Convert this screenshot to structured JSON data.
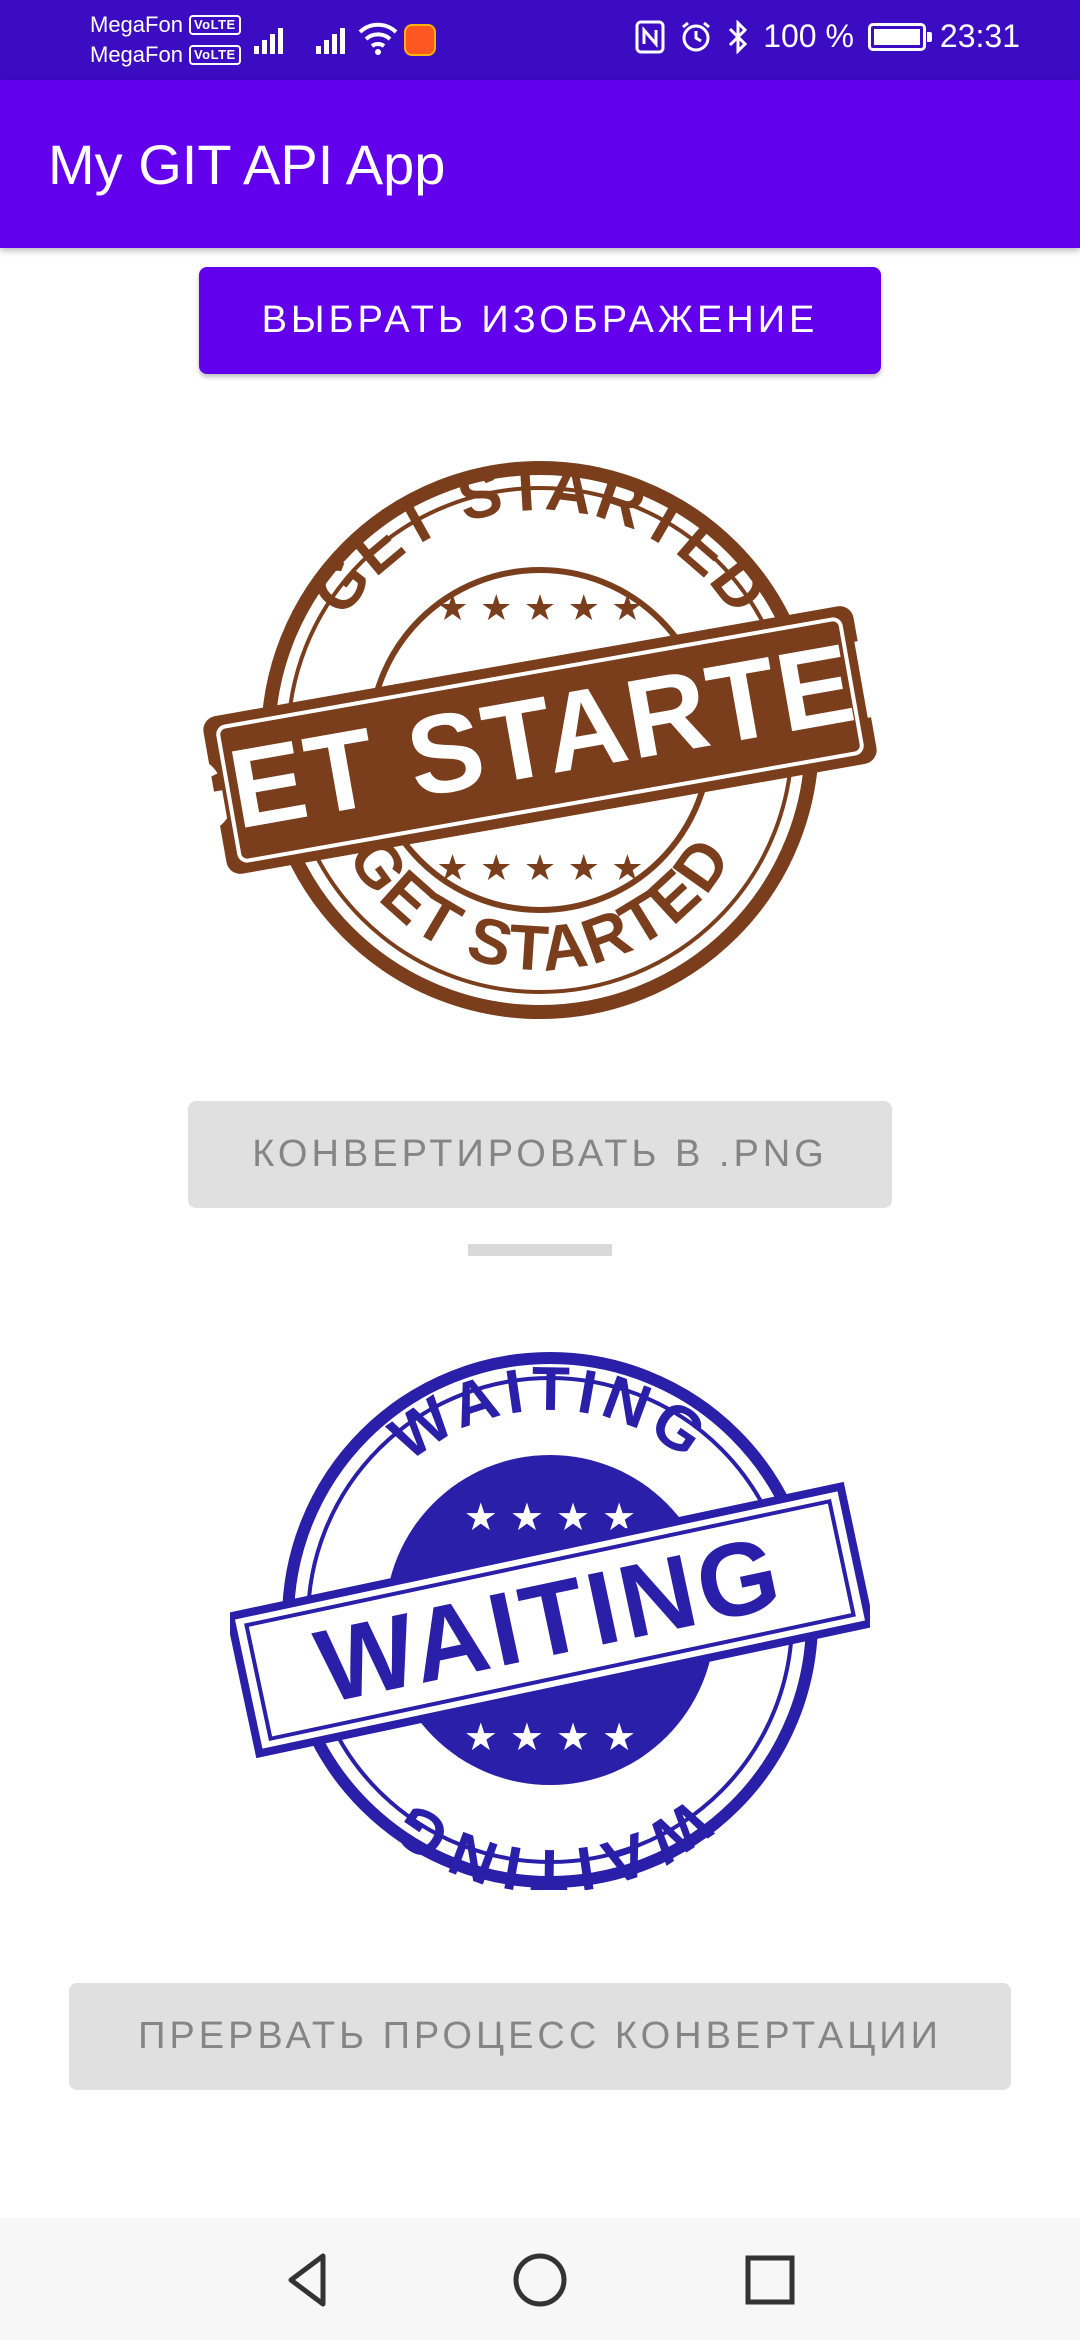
{
  "status_bar": {
    "carrier_1": "MegaFon",
    "carrier_2": "MegaFon",
    "volte_badge": "VoLTE",
    "battery": "100 %",
    "time": "23:31",
    "icons": [
      "signal-icon",
      "wifi-icon",
      "notification-icon",
      "nfc-icon",
      "alarm-icon",
      "bluetooth-icon",
      "battery-icon"
    ]
  },
  "app_bar": {
    "title": "My GIT API App"
  },
  "buttons": {
    "select_image": "ВЫБРАТЬ ИЗОБРАЖЕНИЕ",
    "convert_png": "КОНВЕРТИРОВАТЬ В .PNG",
    "abort_conversion": "ПРЕРВАТЬ ПРОЦЕСС КОНВЕРТАЦИИ"
  },
  "images": {
    "source_stamp_text": "GET STARTED",
    "result_stamp_text": "WAITING"
  },
  "colors": {
    "status_bar": "#3c0cc2",
    "primary": "#6200ee",
    "disabled_bg": "#e0e0e0",
    "disabled_text": "#858585",
    "stamp_brown": "#7a3e1d",
    "stamp_blue": "#2a1fa8"
  },
  "nav_bar": {
    "icons": [
      "back-icon",
      "home-icon",
      "recents-icon"
    ]
  }
}
